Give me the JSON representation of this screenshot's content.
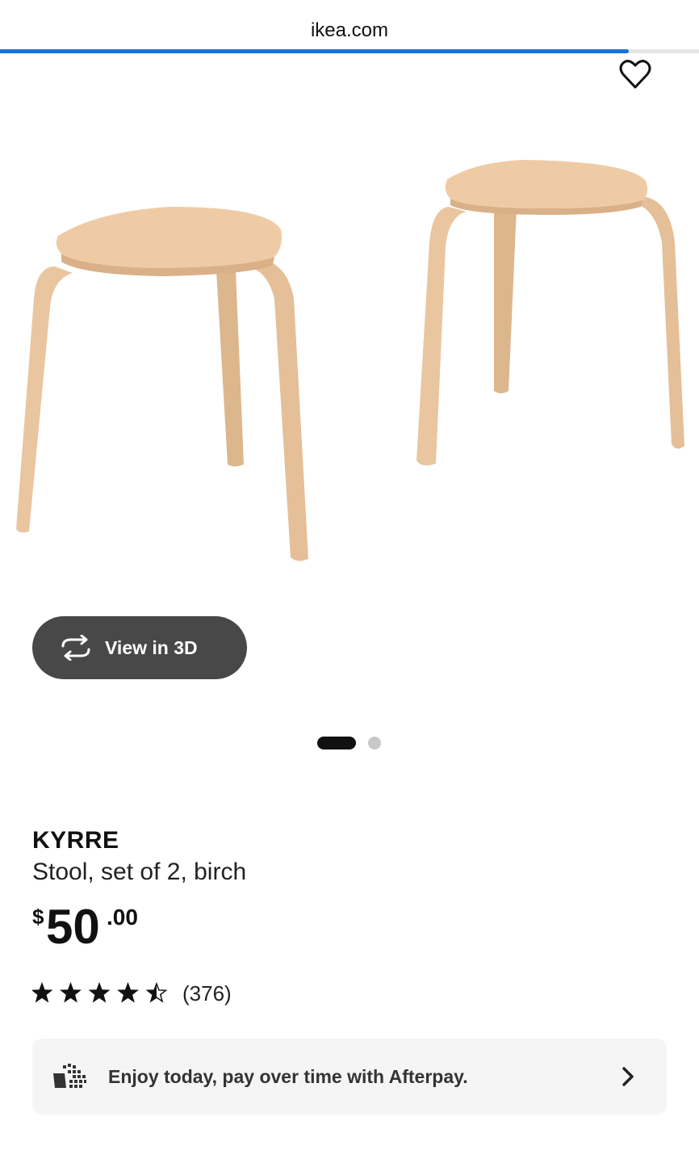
{
  "browser": {
    "url": "ikea.com",
    "load_progress_percent": 90
  },
  "icons": {
    "favorite": "heart-outline-icon",
    "view_3d": "rotate-3d-icon",
    "afterpay": "afterpay-logo-icon",
    "chevron": "chevron-right-icon",
    "rating": "star-icon"
  },
  "gallery": {
    "view_3d_label": "View in 3D",
    "image_count": 2,
    "active_image_index": 0
  },
  "product": {
    "brand": "KYRRE",
    "description": "Stool, set of 2, birch",
    "price": {
      "currency_symbol": "$",
      "whole": "50",
      "cents": ".00"
    },
    "rating": {
      "stars": 4.5,
      "max": 5,
      "count_label": "(376)"
    }
  },
  "afterpay": {
    "label": "Enjoy today, pay over time with Afterpay."
  },
  "colors": {
    "accent_progress": "#1a73d9",
    "pill_background": "#484848",
    "panel_background": "#f5f5f5",
    "wood": "#ecc9a4"
  }
}
